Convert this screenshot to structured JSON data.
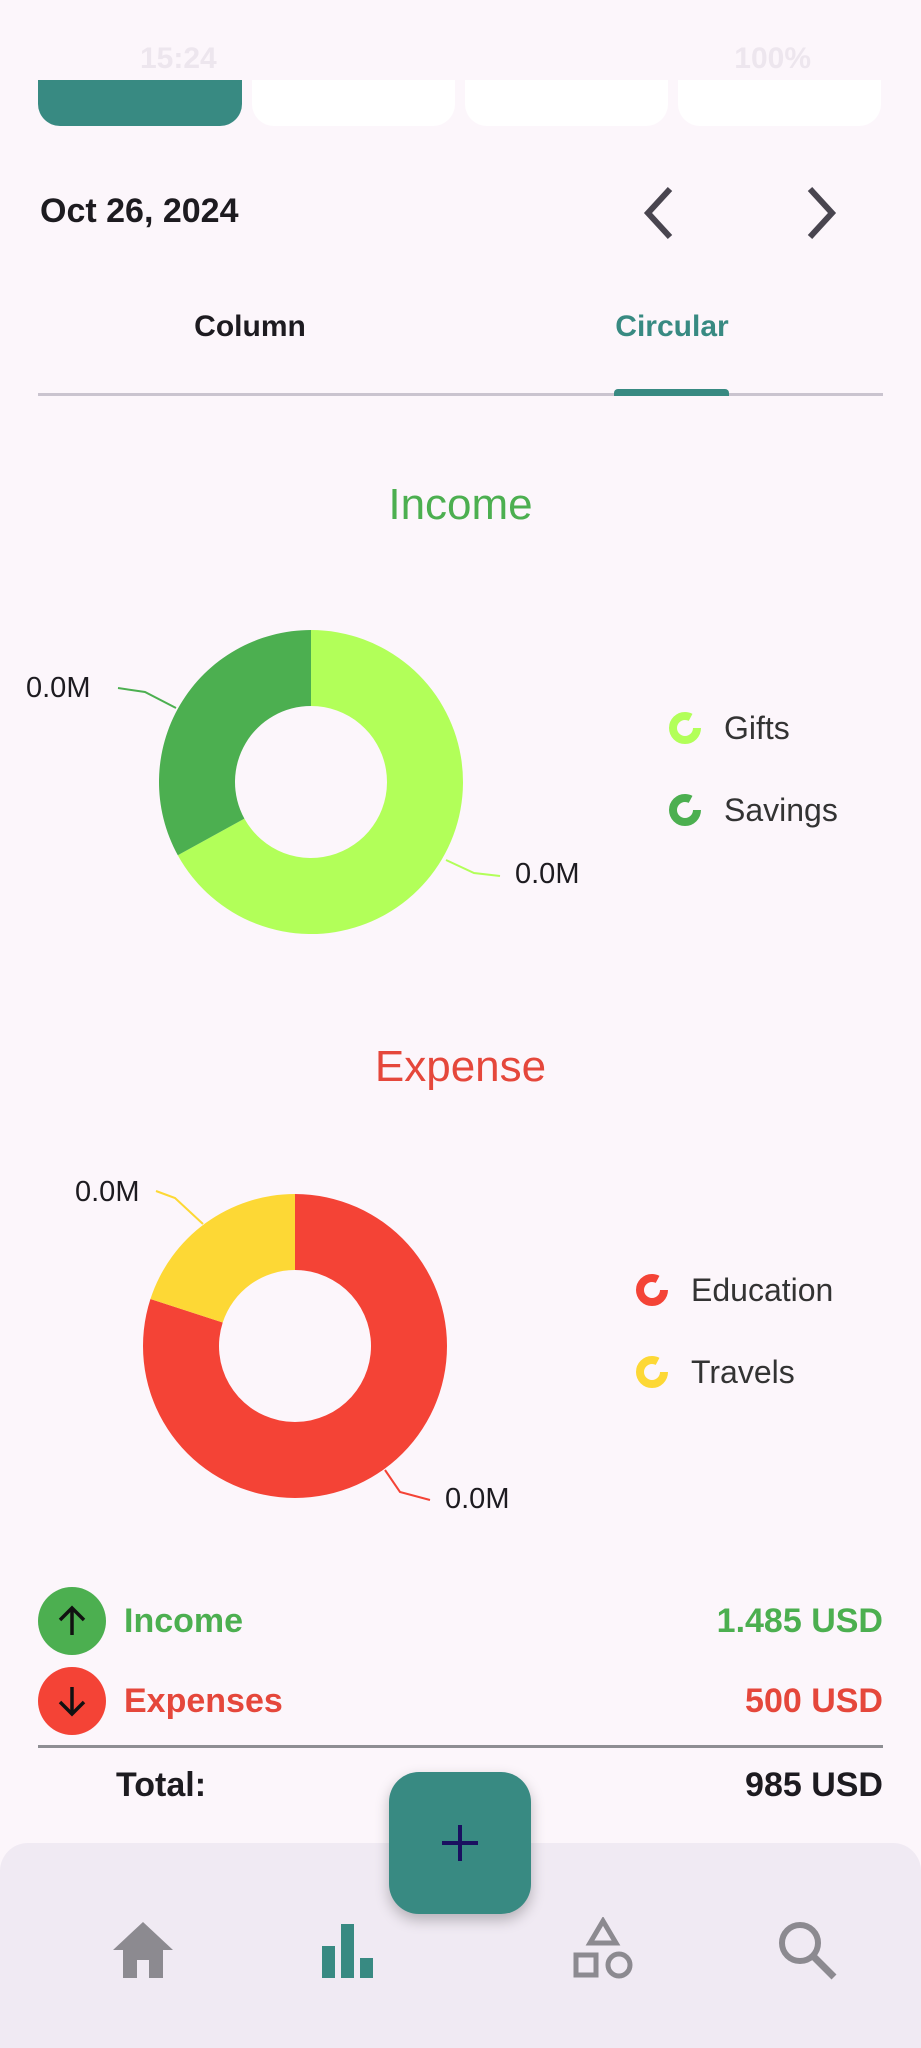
{
  "status_bar": {
    "time": "15:24",
    "battery": "100%"
  },
  "date_nav": {
    "date": "Oct 26, 2024"
  },
  "view_tabs": [
    {
      "label": "Column",
      "active": false
    },
    {
      "label": "Circular",
      "active": true
    }
  ],
  "colors": {
    "accent": "#388a82",
    "income": "#4caf50",
    "expense": "#e5473b",
    "gifts": "#b2ff59",
    "savings": "#4caf50",
    "education": "#f44336",
    "travels": "#fdd835"
  },
  "income_chart": {
    "title": "Income",
    "labels": {
      "savings": "0.0M",
      "gifts": "0.0M"
    },
    "legend": [
      "Gifts",
      "Savings"
    ]
  },
  "expense_chart": {
    "title": "Expense",
    "labels": {
      "travels": "0.0M",
      "education": "0.0M"
    },
    "legend": [
      "Education",
      "Travels"
    ]
  },
  "chart_data": [
    {
      "type": "pie",
      "title": "Income",
      "categories": [
        "Gifts",
        "Savings"
      ],
      "values": [
        67,
        33
      ]
    },
    {
      "type": "pie",
      "title": "Expense",
      "categories": [
        "Education",
        "Travels"
      ],
      "values": [
        80,
        20
      ]
    }
  ],
  "summary": {
    "income_label": "Income",
    "income_value": "1.485 USD",
    "expenses_label": "Expenses",
    "expenses_value": "500 USD",
    "total_label": "Total:",
    "total_value": "985 USD"
  },
  "bottom_nav": {
    "items": [
      "home-icon",
      "bar-chart-icon",
      "shapes-icon",
      "search-icon"
    ],
    "fab": "plus-icon"
  }
}
